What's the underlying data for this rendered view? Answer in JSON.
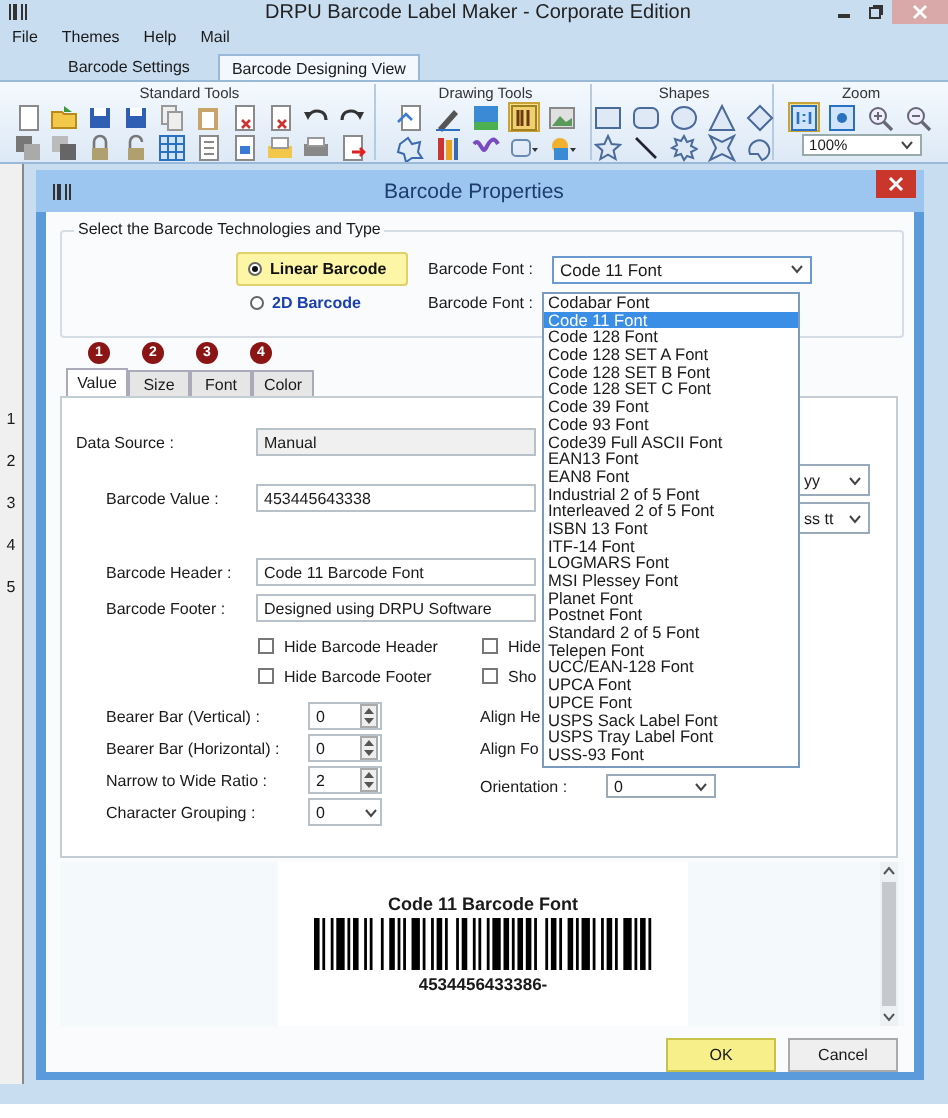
{
  "window": {
    "title": "DRPU Barcode Label Maker - Corporate Edition"
  },
  "menu": [
    "File",
    "Themes",
    "Help",
    "Mail"
  ],
  "tabs": [
    {
      "label": "Barcode Settings",
      "selected": false
    },
    {
      "label": "Barcode Designing View",
      "selected": true
    }
  ],
  "ribbon": [
    {
      "kind": "standard",
      "title": "Standard Tools",
      "tools": [
        {
          "selected": false
        },
        {
          "selected": false
        },
        {
          "selected": false
        },
        {
          "selected": false
        },
        {
          "selected": false
        },
        {
          "selected": false
        },
        {
          "selected": false
        },
        {
          "selected": false
        },
        {
          "selected": false
        },
        {
          "selected": false
        },
        {
          "selected": false
        },
        {
          "selected": false
        },
        {
          "selected": false
        },
        {
          "selected": false
        },
        {
          "selected": false
        },
        {
          "selected": false
        },
        {
          "selected": false
        },
        {
          "selected": false
        },
        {
          "selected": false
        },
        {
          "selected": false
        }
      ]
    },
    {
      "kind": "drawing",
      "title": "Drawing Tools",
      "tools": [
        {
          "selected": false
        },
        {
          "selected": false
        },
        {
          "selected": false
        },
        {
          "selected": true
        },
        {
          "selected": false
        },
        {
          "selected": false
        },
        {
          "selected": false
        },
        {
          "selected": false
        },
        {
          "selected": false
        },
        {
          "selected": false
        }
      ]
    },
    {
      "kind": "shapes",
      "title": "Shapes",
      "tools": [
        {
          "selected": false
        },
        {
          "selected": false
        },
        {
          "selected": false
        },
        {
          "selected": false
        },
        {
          "selected": false
        },
        {
          "selected": false
        },
        {
          "selected": false
        },
        {
          "selected": false
        },
        {
          "selected": false
        },
        {
          "selected": false
        }
      ]
    },
    {
      "kind": "zoom",
      "title": "Zoom",
      "tools": [
        {
          "selected": true
        },
        {
          "selected": false
        },
        {
          "selected": false
        },
        {
          "selected": false
        }
      ],
      "zoom_value": "100%"
    }
  ],
  "ruler": [
    "1",
    "2",
    "3",
    "4",
    "5"
  ],
  "dialog": {
    "title": "Barcode Properties",
    "group_label": "Select the Barcode Technologies and Type",
    "types": [
      {
        "label": "Linear Barcode",
        "selected": true,
        "font_label": "Barcode Font :",
        "font_value": "Code 11 Font"
      },
      {
        "label": "2D Barcode",
        "selected": false,
        "font_label": "Barcode Font :"
      }
    ],
    "font_options": [
      {
        "label": "Codabar Font",
        "selected": false
      },
      {
        "label": "Code 11 Font",
        "selected": true
      },
      {
        "label": "Code 128 Font",
        "selected": false
      },
      {
        "label": "Code 128 SET A Font",
        "selected": false
      },
      {
        "label": "Code 128 SET B Font",
        "selected": false
      },
      {
        "label": "Code 128 SET C Font",
        "selected": false
      },
      {
        "label": "Code 39 Font",
        "selected": false
      },
      {
        "label": "Code 93 Font",
        "selected": false
      },
      {
        "label": "Code39 Full ASCII Font",
        "selected": false
      },
      {
        "label": "EAN13 Font",
        "selected": false
      },
      {
        "label": "EAN8 Font",
        "selected": false
      },
      {
        "label": "Industrial 2 of 5 Font",
        "selected": false
      },
      {
        "label": "Interleaved 2 of 5 Font",
        "selected": false
      },
      {
        "label": "ISBN 13 Font",
        "selected": false
      },
      {
        "label": "ITF-14 Font",
        "selected": false
      },
      {
        "label": "LOGMARS Font",
        "selected": false
      },
      {
        "label": "MSI Plessey Font",
        "selected": false
      },
      {
        "label": "Planet Font",
        "selected": false
      },
      {
        "label": "Postnet Font",
        "selected": false
      },
      {
        "label": "Standard 2 of 5 Font",
        "selected": false
      },
      {
        "label": "Telepen Font",
        "selected": false
      },
      {
        "label": "UCC/EAN-128 Font",
        "selected": false
      },
      {
        "label": "UPCA Font",
        "selected": false
      },
      {
        "label": "UPCE Font",
        "selected": false
      },
      {
        "label": "USPS Sack Label Font",
        "selected": false
      },
      {
        "label": "USPS Tray Label Font",
        "selected": false
      },
      {
        "label": "USS-93 Font",
        "selected": false
      }
    ],
    "steps": [
      "1",
      "2",
      "3",
      "4"
    ],
    "tabs": [
      {
        "label": "Value",
        "selected": true
      },
      {
        "label": "Size",
        "selected": false
      },
      {
        "label": "Font",
        "selected": false
      },
      {
        "label": "Color",
        "selected": false
      }
    ],
    "data_source": {
      "label": "Data Source :",
      "value": "Manual"
    },
    "barcode_value": {
      "label": "Barcode Value :",
      "value": "453445643338"
    },
    "partial_selects": [
      "yy",
      "ss tt"
    ],
    "header": {
      "label": "Barcode Header :",
      "value": "Code 11 Barcode Font"
    },
    "footer": {
      "label": "Barcode Footer :",
      "value": "Designed using DRPU Software"
    },
    "checkboxes": [
      {
        "label": "Hide Barcode Header",
        "checked": false
      },
      {
        "label": "Hide",
        "checked": false
      },
      {
        "label": "Hide Barcode Footer",
        "checked": false
      },
      {
        "label": "Sho",
        "checked": false
      }
    ],
    "numeric": [
      {
        "label": "Bearer Bar (Vertical) :",
        "value": "0",
        "kind": "spinner"
      },
      {
        "label": "Bearer Bar (Horizontal) :",
        "value": "0",
        "kind": "spinner"
      },
      {
        "label": "Narrow to Wide Ratio :",
        "value": "2",
        "kind": "spinner"
      },
      {
        "label": "Character Grouping :",
        "value": "0",
        "kind": "select"
      }
    ],
    "right_labels": [
      "Align He",
      "Align Fo"
    ],
    "orientation": {
      "label": "Orientation :",
      "value": "0"
    },
    "preview": {
      "header": "Code 11 Barcode Font",
      "text": "4534456433386-"
    },
    "buttons": [
      {
        "label": "OK",
        "focused": true
      },
      {
        "label": "Cancel",
        "focused": false
      }
    ]
  }
}
